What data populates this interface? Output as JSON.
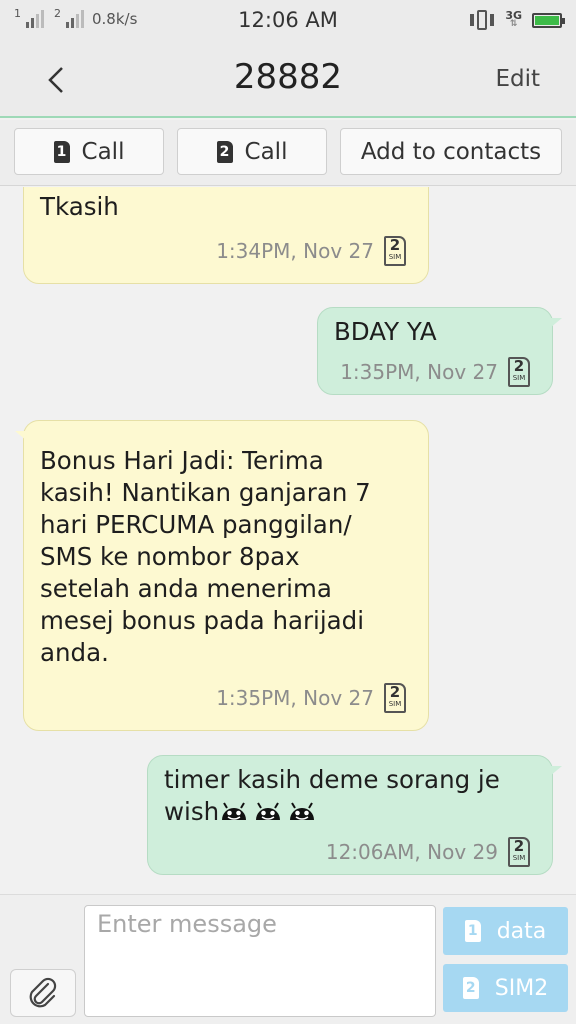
{
  "status_bar": {
    "sim1_label": "1",
    "sim2_label": "2",
    "speed": "0.8k/s",
    "time": "12:06 AM",
    "network": "3G"
  },
  "header": {
    "title": "28882",
    "edit_label": "Edit"
  },
  "actions": {
    "call1_sim": "1",
    "call1_label": "Call",
    "call2_sim": "2",
    "call2_label": "Call",
    "add_contact_label": "Add to contacts"
  },
  "messages": [
    {
      "direction": "incoming",
      "text": "Tkasih",
      "timestamp": "1:34PM, Nov 27",
      "sim": "2",
      "sim_text": "SIM"
    },
    {
      "direction": "outgoing",
      "text": "BDAY YA",
      "timestamp": "1:35PM, Nov 27",
      "sim": "2",
      "sim_text": "SIM"
    },
    {
      "direction": "incoming",
      "text": "Bonus Hari Jadi: Terima\nkasih! Nantikan ganjaran 7\nhari PERCUMA panggilan/\nSMS ke nombor 8pax\nsetelah anda menerima\nmesej bonus pada harijadi\nanda.",
      "timestamp": "1:35PM, Nov 27",
      "sim": "2",
      "sim_text": "SIM"
    },
    {
      "direction": "outgoing",
      "text_line1": "timer kasih deme sorang je",
      "text_line2": "wish",
      "emoji_count": 3,
      "timestamp": "12:06AM, Nov 29",
      "sim": "2",
      "sim_text": "SIM"
    }
  ],
  "compose": {
    "placeholder": "Enter message",
    "send1_sim": "1",
    "send1_label": "data",
    "send2_sim": "2",
    "send2_label": "SIM2"
  },
  "colors": {
    "incoming_bubble": "#fdf9d1",
    "outgoing_bubble": "#cfeedb",
    "send_button": "#a6d8f2",
    "header_divider": "#9ed9b7"
  }
}
